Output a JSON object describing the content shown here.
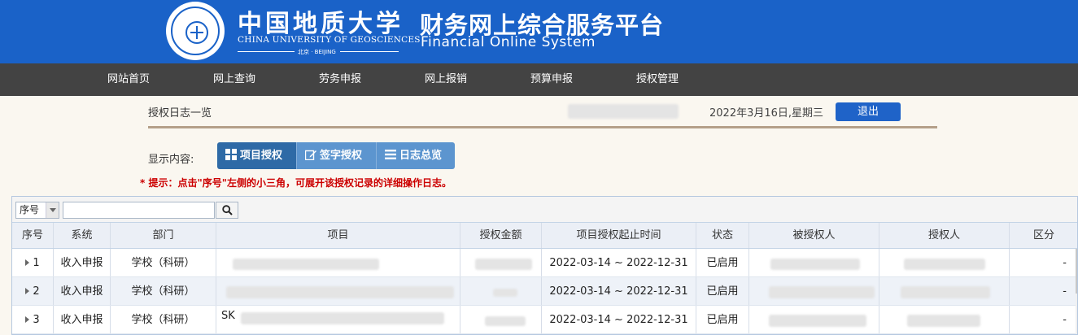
{
  "header": {
    "univ_cn": "中国地质大学",
    "univ_en": "CHINA UNIVERSITY OF GEOSCIENCES",
    "univ_city": "北京 · BEIJING",
    "sys_cn": "财务网上综合服务平台",
    "sys_en": "Financial Online System",
    "logo_icon": "university-seal-icon"
  },
  "nav": [
    "网站首页",
    "网上查询",
    "劳务申报",
    "网上报销",
    "预算申报",
    "授权管理"
  ],
  "title_bar": {
    "title": "授权日志一览",
    "date": "2022年3月16日,星期三",
    "logout": "退出"
  },
  "view": {
    "label": "显示内容:",
    "tabs": [
      {
        "label": "项目授权",
        "icon": "grid-icon",
        "active": true
      },
      {
        "label": "签字授权",
        "icon": "edit-icon",
        "active": false
      },
      {
        "label": "日志总览",
        "icon": "list-icon",
        "active": false
      }
    ],
    "tip": "* 提示：点击\"序号\"左侧的小三角，可展开该授权记录的详细操作日志。"
  },
  "toolbar": {
    "field_select": "序号",
    "search_value": "",
    "search_icon": "search-icon"
  },
  "columns": [
    "序号",
    "系统",
    "部门",
    "项目",
    "授权金额",
    "项目授权起止时间",
    "状态",
    "被授权人",
    "授权人",
    "区分"
  ],
  "rows": [
    {
      "no": "1",
      "system": "收入申报",
      "dept": "学校（科研）",
      "project": "",
      "amount": "",
      "period": "2022-03-14 ~ 2022-12-31",
      "status": "已启用",
      "grantee": "",
      "grantor": "",
      "kind": "-"
    },
    {
      "no": "2",
      "system": "收入申报",
      "dept": "学校（科研）",
      "project": "",
      "amount": "",
      "period": "2022-03-14 ~ 2022-12-31",
      "status": "已启用",
      "grantee": "",
      "grantor": "",
      "kind": "-"
    },
    {
      "no": "3",
      "system": "收入申报",
      "dept": "学校（科研）",
      "project": "SK",
      "amount": "",
      "period": "2022-03-14 ~ 2022-12-31",
      "status": "已启用",
      "grantee": "",
      "grantor": "",
      "kind": "-"
    }
  ],
  "colors": {
    "header_blue": "#1a62c8",
    "nav_dark": "#434343",
    "tab_blue": "#5c95cf",
    "tip_red": "#cc0000",
    "rule_brown": "#b4a089"
  }
}
